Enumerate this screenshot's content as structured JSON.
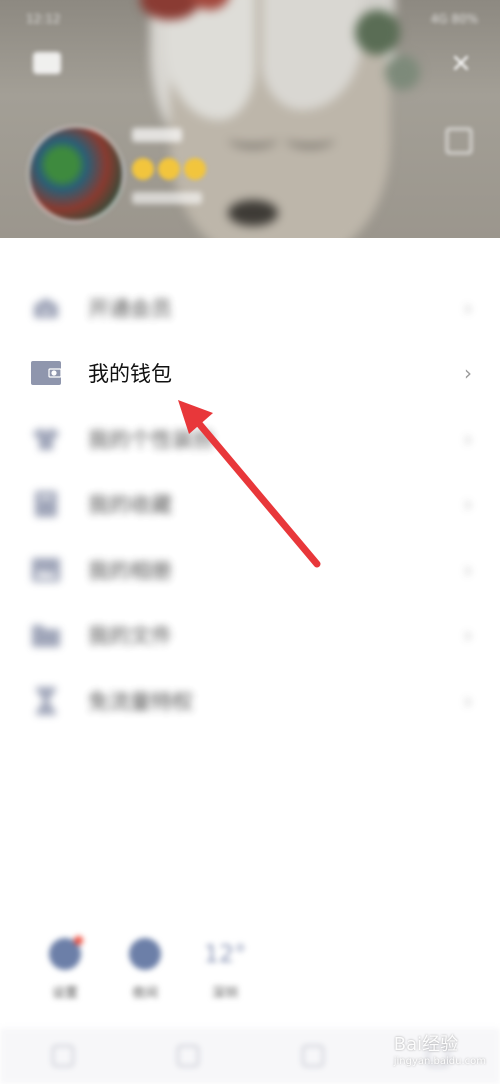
{
  "status": {
    "time": "12:12",
    "right": "4G 80%"
  },
  "profile": {
    "nickname": "w_f",
    "signature": "Lv.Sig"
  },
  "menu": [
    {
      "label": "开通会员",
      "icon": "vip-icon",
      "blurred": true
    },
    {
      "label": "我的钱包",
      "icon": "wallet-icon",
      "blurred": false
    },
    {
      "label": "我的个性装扮",
      "icon": "shirt-icon",
      "blurred": true
    },
    {
      "label": "我的收藏",
      "icon": "bookmark-icon",
      "blurred": true
    },
    {
      "label": "我的相册",
      "icon": "album-icon",
      "blurred": true
    },
    {
      "label": "我的文件",
      "icon": "folder-icon",
      "blurred": true
    },
    {
      "label": "免流量特权",
      "icon": "hourglass-icon",
      "blurred": true
    }
  ],
  "chevron": "›",
  "close_glyph": "×",
  "quick": [
    {
      "label": "设置"
    },
    {
      "label": "夜间"
    },
    {
      "label": "12°",
      "sub": "深圳"
    }
  ],
  "watermark": {
    "main": "Bai经验",
    "sub": "jingyan.baidu.com"
  },
  "colors": {
    "arrow": "#e8373a",
    "icon": "#8f96ad",
    "chevron": "#9a9a9a"
  }
}
